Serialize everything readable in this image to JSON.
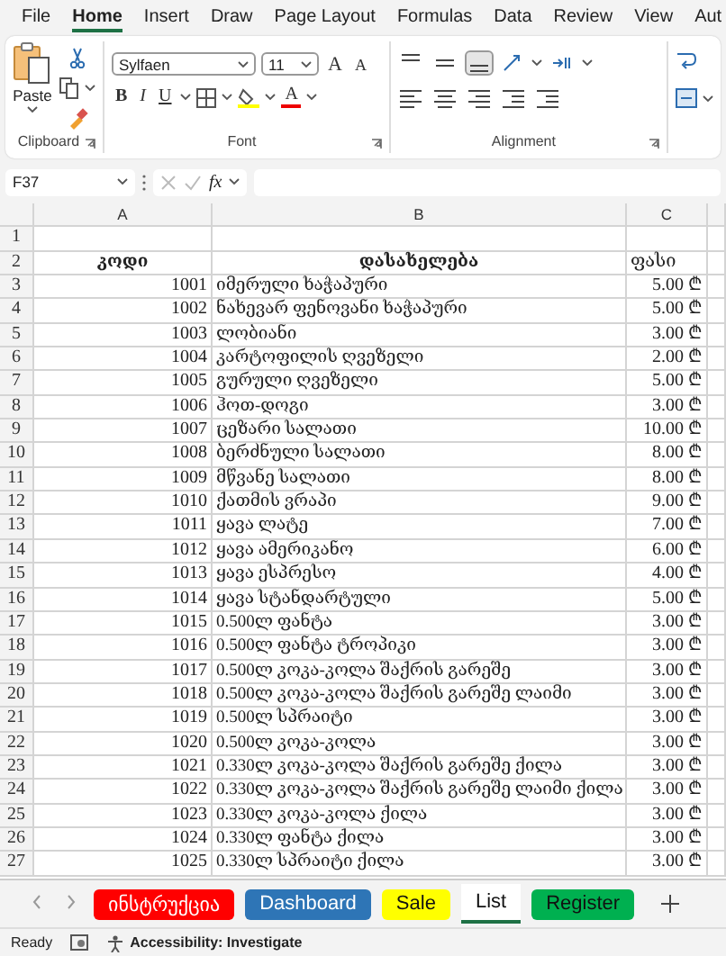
{
  "menu": [
    {
      "label": "File",
      "selected": false
    },
    {
      "label": "Home",
      "selected": true
    },
    {
      "label": "Insert",
      "selected": false
    },
    {
      "label": "Draw",
      "selected": false
    },
    {
      "label": "Page Layout",
      "selected": false
    },
    {
      "label": "Formulas",
      "selected": false
    },
    {
      "label": "Data",
      "selected": false
    },
    {
      "label": "Review",
      "selected": false
    },
    {
      "label": "View",
      "selected": false
    },
    {
      "label": "Aut",
      "selected": false
    }
  ],
  "ribbon": {
    "paste_label": "Paste",
    "font_name": "Sylfaen",
    "font_size": "11",
    "grow_label": "A",
    "shrink_label": "A",
    "bold_label": "B",
    "italic_label": "I",
    "underline_label": "U",
    "font_color_label": "A",
    "groups": [
      "Clipboard",
      "Font",
      "Alignment"
    ]
  },
  "formula_bar": {
    "name_box": "F37",
    "fx_label": "fx"
  },
  "sheet": {
    "columns": [
      "A",
      "B",
      "C"
    ],
    "rows": [
      {
        "number": "1",
        "kind": "empty",
        "cells": []
      },
      {
        "number": "2",
        "kind": "header",
        "cells": [
          "კოდი",
          "დასახელება",
          "ფასი"
        ]
      },
      {
        "number": "3",
        "kind": "item",
        "cells": [
          "1001",
          "იმერული ხაჭაპური",
          "5.00 ₾"
        ]
      },
      {
        "number": "4",
        "kind": "item",
        "cells": [
          "1002",
          "ნახევარ ფენოვანი ხაჭაპური",
          "5.00 ₾"
        ]
      },
      {
        "number": "5",
        "kind": "item",
        "cells": [
          "1003",
          "ლობიანი",
          "3.00 ₾"
        ]
      },
      {
        "number": "6",
        "kind": "item",
        "cells": [
          "1004",
          "კარტოფილის ღვეზელი",
          "2.00 ₾"
        ]
      },
      {
        "number": "7",
        "kind": "item",
        "cells": [
          "1005",
          "გურული ღვეზელი",
          "5.00 ₾"
        ]
      },
      {
        "number": "8",
        "kind": "item",
        "cells": [
          "1006",
          "ჰოთ-დოგი",
          "3.00 ₾"
        ]
      },
      {
        "number": "9",
        "kind": "item",
        "cells": [
          "1007",
          "ცეზარი სალათი",
          "10.00 ₾"
        ]
      },
      {
        "number": "10",
        "kind": "item",
        "cells": [
          "1008",
          "ბერძნული სალათი",
          "8.00 ₾"
        ]
      },
      {
        "number": "11",
        "kind": "item",
        "cells": [
          "1009",
          "მწვანე სალათი",
          "8.00 ₾"
        ]
      },
      {
        "number": "12",
        "kind": "item",
        "cells": [
          "1010",
          "ქათმის ვრაპი",
          "9.00 ₾"
        ]
      },
      {
        "number": "13",
        "kind": "item",
        "cells": [
          "1011",
          "ყავა ლატე",
          "7.00 ₾"
        ]
      },
      {
        "number": "14",
        "kind": "item",
        "cells": [
          "1012",
          "ყავა ამერიკანო",
          "6.00 ₾"
        ]
      },
      {
        "number": "15",
        "kind": "item",
        "cells": [
          "1013",
          "ყავა ესპრესო",
          "4.00 ₾"
        ]
      },
      {
        "number": "16",
        "kind": "item",
        "cells": [
          "1014",
          "ყავა სტანდარტული",
          "5.00 ₾"
        ]
      },
      {
        "number": "17",
        "kind": "item",
        "cells": [
          "1015",
          "0.500ლ ფანტა",
          "3.00 ₾"
        ]
      },
      {
        "number": "18",
        "kind": "item",
        "cells": [
          "1016",
          "0.500ლ ფანტა ტროპიკი",
          "3.00 ₾"
        ]
      },
      {
        "number": "19",
        "kind": "item",
        "cells": [
          "1017",
          "0.500ლ კოკა-კოლა შაქრის გარეშე",
          "3.00 ₾"
        ]
      },
      {
        "number": "20",
        "kind": "item",
        "cells": [
          "1018",
          "0.500ლ კოკა-კოლა შაქრის გარეშე ლაიმი",
          "3.00 ₾"
        ]
      },
      {
        "number": "21",
        "kind": "item",
        "cells": [
          "1019",
          "0.500ლ სპრაიტი",
          "3.00 ₾"
        ]
      },
      {
        "number": "22",
        "kind": "item",
        "cells": [
          "1020",
          "0.500ლ კოკა-კოლა",
          "3.00 ₾"
        ]
      },
      {
        "number": "23",
        "kind": "item",
        "cells": [
          "1021",
          "0.330ლ კოკა-კოლა შაქრის გარეშე ქილა",
          "3.00 ₾"
        ]
      },
      {
        "number": "24",
        "kind": "item",
        "cells": [
          "1022",
          "0.330ლ კოკა-კოლა შაქრის გარეშე ლაიმი ქილა",
          "3.00 ₾"
        ]
      },
      {
        "number": "25",
        "kind": "item",
        "cells": [
          "1023",
          "0.330ლ კოკა-კოლა ქილა",
          "3.00 ₾"
        ]
      },
      {
        "number": "26",
        "kind": "item",
        "cells": [
          "1024",
          "0.330ლ ფანტა ქილა",
          "3.00 ₾"
        ]
      },
      {
        "number": "27",
        "kind": "item",
        "cells": [
          "1025",
          "0.330ლ სპრაიტი ქილა",
          "3.00 ₾"
        ]
      }
    ]
  },
  "sheet_tabs": [
    {
      "label": "ინსტრუქცია",
      "color": "#ff0000",
      "light_text": true,
      "selected": false
    },
    {
      "label": "Dashboard",
      "color": "#2e75b6",
      "light_text": true,
      "selected": false
    },
    {
      "label": "Sale",
      "color": "#ffff00",
      "light_text": false,
      "selected": false
    },
    {
      "label": "List",
      "color": "#ffffff",
      "light_text": false,
      "selected": true
    },
    {
      "label": "Register",
      "color": "#00b050",
      "light_text": false,
      "selected": false
    }
  ],
  "status_bar": {
    "ready": "Ready",
    "accessibility": "Accessibility: Investigate"
  }
}
